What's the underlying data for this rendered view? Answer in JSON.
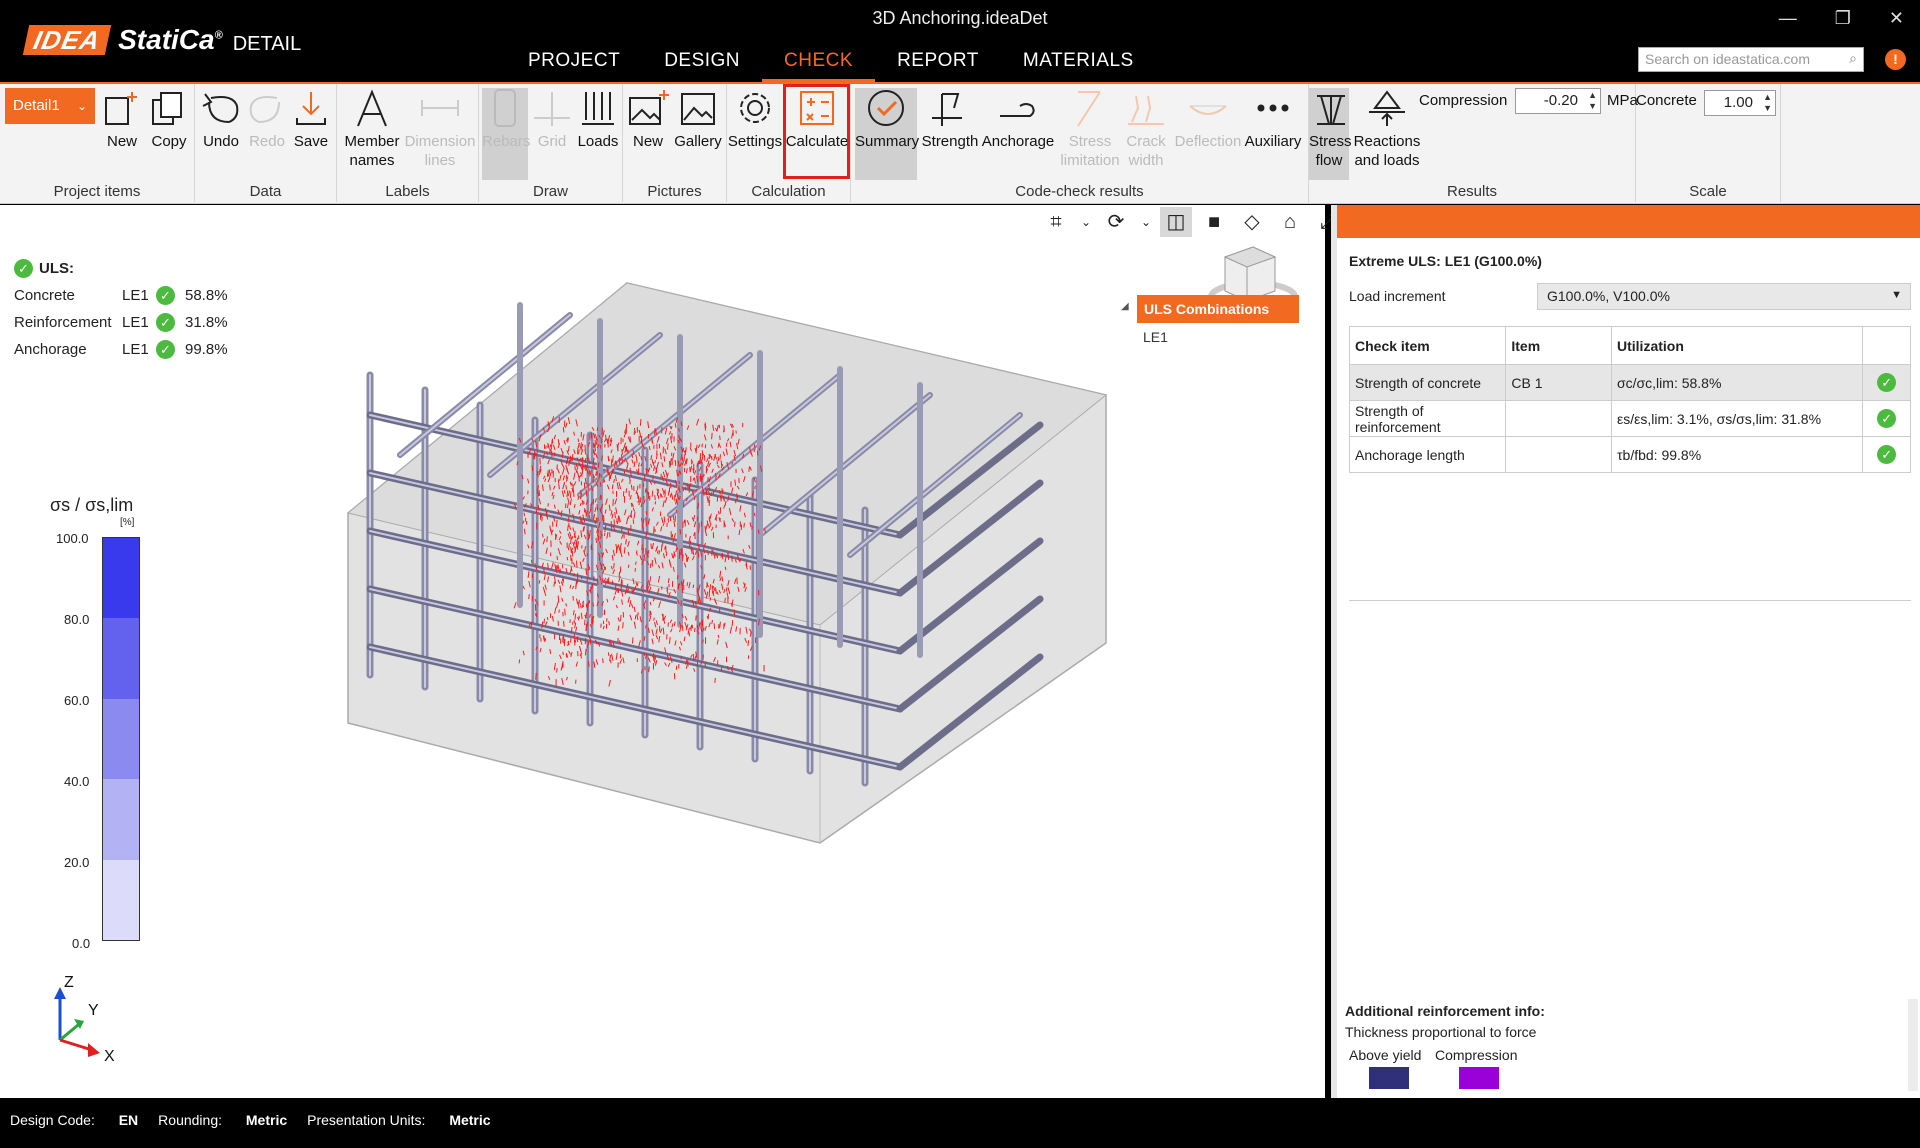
{
  "app": {
    "title": "3D Anchoring.ideaDet",
    "logo_idea": "IDEA",
    "logo_statica": "StatiCa",
    "logo_reg": "®",
    "logo_product": "DETAIL",
    "search_placeholder": "Search on ideastatica.com"
  },
  "menu": [
    {
      "label": "PROJECT"
    },
    {
      "label": "DESIGN"
    },
    {
      "label": "CHECK"
    },
    {
      "label": "REPORT"
    },
    {
      "label": "MATERIALS"
    }
  ],
  "ribbon": {
    "detail_selector": "Detail1",
    "groups": {
      "project_items": "Project items",
      "data": "Data",
      "labels": "Labels",
      "draw": "Draw",
      "pictures": "Pictures",
      "calculation": "Calculation",
      "code_check": "Code-check results",
      "results": "Results",
      "scale": "Scale"
    },
    "buttons": {
      "new": "New",
      "copy": "Copy",
      "undo": "Undo",
      "redo": "Redo",
      "save": "Save",
      "member_names_1": "Member",
      "member_names_2": "names",
      "dimension_lines_1": "Dimension",
      "dimension_lines_2": "lines",
      "rebars": "Rebars",
      "grid": "Grid",
      "loads": "Loads",
      "pic_new": "New",
      "gallery": "Gallery",
      "settings": "Settings",
      "calculate": "Calculate",
      "summary": "Summary",
      "strength": "Strength",
      "anchorage": "Anchorage",
      "stress_limitation_1": "Stress",
      "stress_limitation_2": "limitation",
      "crack_width_1": "Crack",
      "crack_width_2": "width",
      "deflection": "Deflection",
      "auxiliary": "Auxiliary",
      "stress_flow_1": "Stress",
      "stress_flow_2": "flow",
      "reactions_1": "Reactions",
      "reactions_2": "and loads"
    },
    "compression_label": "Compression",
    "compression_value": "-0.20",
    "compression_unit": "MPa",
    "concrete_label": "Concrete",
    "concrete_value": "1.00"
  },
  "viewport": {
    "uls_header": "ULS:",
    "uls_rows": [
      {
        "name": "Concrete",
        "le": "LE1",
        "pct": "58.8%"
      },
      {
        "name": "Reinforcement",
        "le": "LE1",
        "pct": "31.8%"
      },
      {
        "name": "Anchorage",
        "le": "LE1",
        "pct": "99.8%"
      }
    ],
    "legend_title": "σs / σs,lim",
    "legend_unit": "[%]",
    "legend_ticks": [
      "100.0",
      "80.0",
      "60.0",
      "40.0",
      "20.0",
      "0.0"
    ],
    "legend_colors": [
      "#3939ee",
      "#6262ee",
      "#8a8af0",
      "#b2b2f4",
      "#dcdcfa"
    ],
    "combos_header": "ULS Combinations",
    "combos_item": "LE1",
    "axis_z": "Z",
    "axis_y": "Y",
    "axis_x": "X"
  },
  "panel": {
    "extreme": "Extreme ULS: LE1 (G100.0%)",
    "load_increment_label": "Load increment",
    "load_increment_value": "G100.0%, V100.0%",
    "table_headers": [
      "Check item",
      "Item",
      "Utilization",
      ""
    ],
    "table_rows": [
      {
        "check": "Strength of concrete",
        "item": "CB 1",
        "util": "σc/σc,lim: 58.8%"
      },
      {
        "check": "Strength of reinforcement",
        "item": "",
        "util": "εs/εs,lim: 3.1%, σs/σs,lim: 31.8%"
      },
      {
        "check": "Anchorage length",
        "item": "",
        "util": "τb/fbd: 99.8%"
      }
    ],
    "add_info_title": "Additional reinforcement info:",
    "add_info_sub": "Thickness proportional to force",
    "above_yield": "Above yield",
    "compression": "Compression",
    "above_yield_color": "#2f2f7a",
    "compression_color": "#9a00d8"
  },
  "status": {
    "design_code_label": "Design Code:",
    "design_code": "EN",
    "rounding_label": "Rounding:",
    "rounding": "Metric",
    "units_label": "Presentation Units:",
    "units": "Metric"
  }
}
